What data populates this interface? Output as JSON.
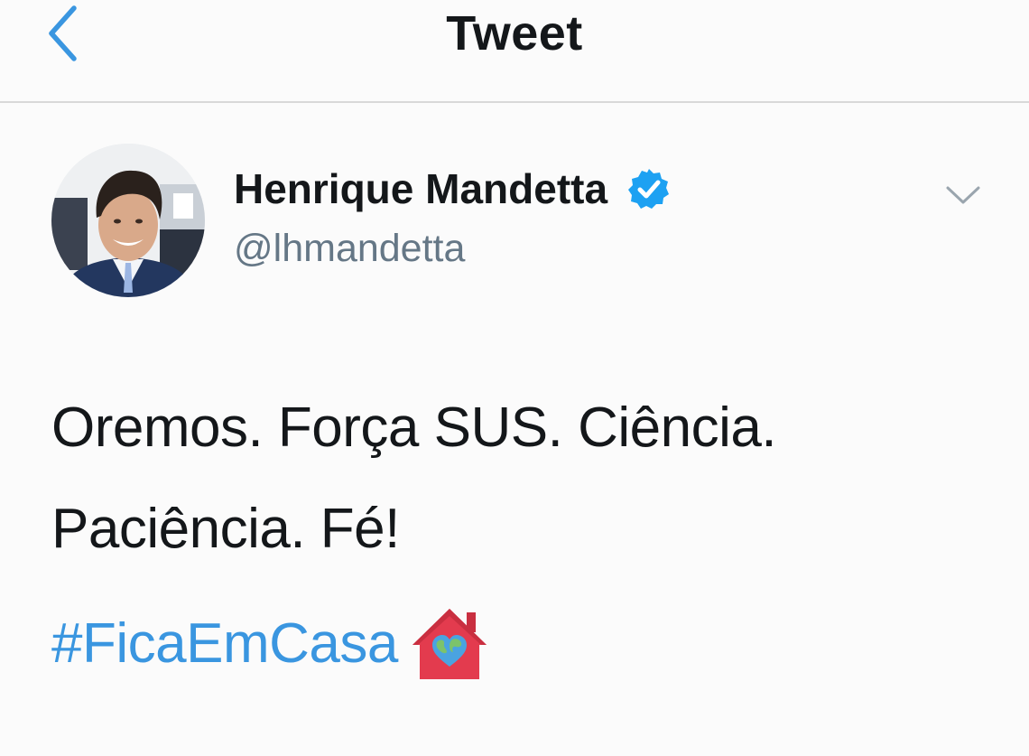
{
  "header": {
    "title": "Tweet",
    "back_icon": "chevron-left-icon"
  },
  "tweet": {
    "author": {
      "display_name": "Henrique Mandetta",
      "handle": "@lhmandetta",
      "verified_icon": "verified-badge-icon"
    },
    "menu_icon": "chevron-down-icon",
    "text_lines": [
      "Oremos. Força SUS. Ciência.",
      "Paciência. Fé!"
    ],
    "hashtag": "#FicaEmCasa",
    "emoji_icon": "house-with-earth-heart-icon"
  },
  "colors": {
    "accent": "#3a96e0",
    "verified": "#1da1f2",
    "text": "#14171a",
    "secondary_text": "#657786",
    "background": "#fbfbfb",
    "house_emoji": "#e33b4e"
  }
}
